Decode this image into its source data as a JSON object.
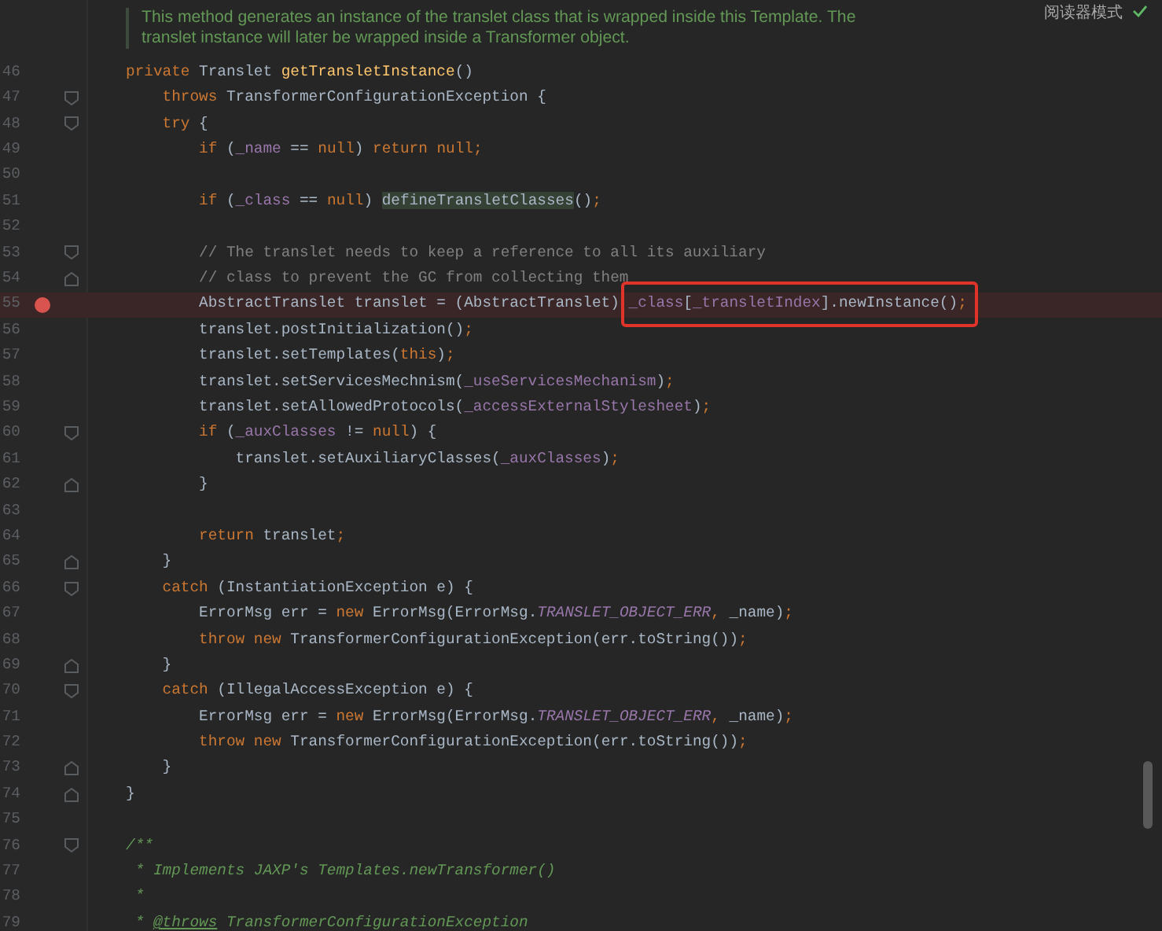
{
  "reader_mode": {
    "label": "阅读器模式"
  },
  "doc_comment": [
    "This method generates an instance of the translet class that is wrapped inside this Template. The",
    "translet instance will later be wrapped inside a Transformer object."
  ],
  "lines": [
    {
      "number": "46",
      "breakpoint": false,
      "tokens": [
        {
          "text": "private ",
          "kind": "keyword"
        },
        {
          "text": "Translet ",
          "kind": "plain"
        },
        {
          "text": "getTransletInstance",
          "kind": "declaration"
        },
        {
          "text": "()",
          "kind": "plain"
        }
      ]
    },
    {
      "number": "47",
      "breakpoint": false,
      "fold_open": true,
      "tokens": [
        {
          "text": "    throws ",
          "kind": "keyword"
        },
        {
          "text": "TransformerConfigurationException {",
          "kind": "plain"
        }
      ]
    },
    {
      "number": "48",
      "breakpoint": false,
      "fold_open": true,
      "tokens": [
        {
          "text": "    try ",
          "kind": "keyword"
        },
        {
          "text": "{",
          "kind": "plain"
        }
      ]
    },
    {
      "number": "49",
      "breakpoint": false,
      "tokens": [
        {
          "text": "        if ",
          "kind": "keyword"
        },
        {
          "text": "(",
          "kind": "plain"
        },
        {
          "text": "_name",
          "kind": "field"
        },
        {
          "text": " == ",
          "kind": "plain"
        },
        {
          "text": "null",
          "kind": "keyword"
        },
        {
          "text": ") ",
          "kind": "plain"
        },
        {
          "text": "return null;",
          "kind": "keyword"
        }
      ]
    },
    {
      "number": "50",
      "breakpoint": false
    },
    {
      "number": "51",
      "breakpoint": false,
      "tokens": [
        {
          "text": "        if ",
          "kind": "keyword"
        },
        {
          "text": "(",
          "kind": "plain"
        },
        {
          "text": "_class",
          "kind": "field"
        },
        {
          "text": " == ",
          "kind": "plain"
        },
        {
          "text": "null",
          "kind": "keyword"
        },
        {
          "text": ") ",
          "kind": "plain"
        },
        {
          "text": "defineTransletClasses",
          "kind": "plain",
          "highlighted": true
        },
        {
          "text": "()",
          "kind": "plain"
        },
        {
          "text": ";",
          "kind": "keyword"
        }
      ]
    },
    {
      "number": "52",
      "breakpoint": false
    },
    {
      "number": "53",
      "breakpoint": false,
      "fold_open": true,
      "tokens": [
        {
          "text": "        // The translet needs to keep a reference to all its auxiliary",
          "kind": "comment"
        }
      ]
    },
    {
      "number": "54",
      "breakpoint": false,
      "fold_close": true,
      "tokens": [
        {
          "text": "        // class to prevent the GC from collecting them",
          "kind": "comment"
        }
      ]
    },
    {
      "number": "55",
      "breakpoint": true,
      "tokens": [
        {
          "text": "        AbstractTranslet translet = (AbstractTranslet) ",
          "kind": "plain"
        },
        {
          "text": "_class",
          "kind": "field",
          "boxed": true
        },
        {
          "text": "[",
          "kind": "plain",
          "boxed": true
        },
        {
          "text": "_transletIndex",
          "kind": "field",
          "boxed": true
        },
        {
          "text": "].newInstance()",
          "kind": "plain",
          "boxed": true
        },
        {
          "text": ";",
          "kind": "keyword",
          "boxed": true
        }
      ]
    },
    {
      "number": "56",
      "breakpoint": false,
      "tokens": [
        {
          "text": "        translet.postInitialization()",
          "kind": "plain"
        },
        {
          "text": ";",
          "kind": "keyword"
        }
      ]
    },
    {
      "number": "57",
      "breakpoint": false,
      "tokens": [
        {
          "text": "        translet.setTemplates(",
          "kind": "plain"
        },
        {
          "text": "this",
          "kind": "keyword"
        },
        {
          "text": ")",
          "kind": "plain"
        },
        {
          "text": ";",
          "kind": "keyword"
        }
      ]
    },
    {
      "number": "58",
      "breakpoint": false,
      "tokens": [
        {
          "text": "        translet.setServicesMechnism(",
          "kind": "plain"
        },
        {
          "text": "_useServicesMechanism",
          "kind": "field"
        },
        {
          "text": ")",
          "kind": "plain"
        },
        {
          "text": ";",
          "kind": "keyword"
        }
      ]
    },
    {
      "number": "59",
      "breakpoint": false,
      "tokens": [
        {
          "text": "        translet.setAllowedProtocols(",
          "kind": "plain"
        },
        {
          "text": "_accessExternalStylesheet",
          "kind": "field"
        },
        {
          "text": ")",
          "kind": "plain"
        },
        {
          "text": ";",
          "kind": "keyword"
        }
      ]
    },
    {
      "number": "60",
      "breakpoint": false,
      "fold_open": true,
      "tokens": [
        {
          "text": "        if ",
          "kind": "keyword"
        },
        {
          "text": "(",
          "kind": "plain"
        },
        {
          "text": "_auxClasses",
          "kind": "field"
        },
        {
          "text": " != ",
          "kind": "plain"
        },
        {
          "text": "null",
          "kind": "keyword"
        },
        {
          "text": ") {",
          "kind": "plain"
        }
      ]
    },
    {
      "number": "61",
      "breakpoint": false,
      "tokens": [
        {
          "text": "            translet.setAuxiliaryClasses(",
          "kind": "plain"
        },
        {
          "text": "_auxClasses",
          "kind": "field"
        },
        {
          "text": ")",
          "kind": "plain"
        },
        {
          "text": ";",
          "kind": "keyword"
        }
      ]
    },
    {
      "number": "62",
      "breakpoint": false,
      "fold_close": true,
      "tokens": [
        {
          "text": "        }",
          "kind": "plain"
        }
      ]
    },
    {
      "number": "63",
      "breakpoint": false
    },
    {
      "number": "64",
      "breakpoint": false,
      "tokens": [
        {
          "text": "        return ",
          "kind": "keyword"
        },
        {
          "text": "translet",
          "kind": "plain"
        },
        {
          "text": ";",
          "kind": "keyword"
        }
      ]
    },
    {
      "number": "65",
      "breakpoint": false,
      "fold_close": true,
      "tokens": [
        {
          "text": "    }",
          "kind": "plain"
        }
      ]
    },
    {
      "number": "66",
      "breakpoint": false,
      "fold_open": true,
      "tokens": [
        {
          "text": "    catch ",
          "kind": "keyword"
        },
        {
          "text": "(InstantiationException e) {",
          "kind": "plain"
        }
      ]
    },
    {
      "number": "67",
      "breakpoint": false,
      "tokens": [
        {
          "text": "        ErrorMsg err = ",
          "kind": "plain"
        },
        {
          "text": "new ",
          "kind": "keyword"
        },
        {
          "text": "ErrorMsg(ErrorMsg.",
          "kind": "plain"
        },
        {
          "text": "TRANSLET_OBJECT_ERR",
          "kind": "constant"
        },
        {
          "text": ", ",
          "kind": "keyword"
        },
        {
          "text": "_name)",
          "kind": "plain"
        },
        {
          "text": ";",
          "kind": "keyword"
        }
      ]
    },
    {
      "number": "68",
      "breakpoint": false,
      "tokens": [
        {
          "text": "        throw new ",
          "kind": "keyword"
        },
        {
          "text": "TransformerConfigurationException(err.toString())",
          "kind": "plain"
        },
        {
          "text": ";",
          "kind": "keyword"
        }
      ]
    },
    {
      "number": "69",
      "breakpoint": false,
      "fold_close": true,
      "tokens": [
        {
          "text": "    }",
          "kind": "plain"
        }
      ]
    },
    {
      "number": "70",
      "breakpoint": false,
      "fold_open": true,
      "tokens": [
        {
          "text": "    catch ",
          "kind": "keyword"
        },
        {
          "text": "(IllegalAccessException e) {",
          "kind": "plain"
        }
      ]
    },
    {
      "number": "71",
      "breakpoint": false,
      "tokens": [
        {
          "text": "        ErrorMsg err = ",
          "kind": "plain"
        },
        {
          "text": "new ",
          "kind": "keyword"
        },
        {
          "text": "ErrorMsg(ErrorMsg.",
          "kind": "plain"
        },
        {
          "text": "TRANSLET_OBJECT_ERR",
          "kind": "constant"
        },
        {
          "text": ", ",
          "kind": "keyword"
        },
        {
          "text": "_name)",
          "kind": "plain"
        },
        {
          "text": ";",
          "kind": "keyword"
        }
      ]
    },
    {
      "number": "72",
      "breakpoint": false,
      "tokens": [
        {
          "text": "        throw new ",
          "kind": "keyword"
        },
        {
          "text": "TransformerConfigurationException(err.toString())",
          "kind": "plain"
        },
        {
          "text": ";",
          "kind": "keyword"
        }
      ]
    },
    {
      "number": "73",
      "breakpoint": false,
      "fold_close": true,
      "tokens": [
        {
          "text": "    }",
          "kind": "plain"
        }
      ]
    },
    {
      "number": "74",
      "breakpoint": false,
      "fold_close": true,
      "tokens": [
        {
          "text": "}",
          "kind": "plain"
        }
      ]
    },
    {
      "number": "75",
      "breakpoint": false
    },
    {
      "number": "76",
      "breakpoint": false,
      "fold_open": true,
      "tokens": [
        {
          "text": "/**",
          "kind": "doc"
        }
      ]
    },
    {
      "number": "77",
      "breakpoint": false,
      "tokens": [
        {
          "text": " * Implements JAXP's Templates.newTransformer()",
          "kind": "doc"
        }
      ]
    },
    {
      "number": "78",
      "breakpoint": false,
      "tokens": [
        {
          "text": " *",
          "kind": "doc"
        }
      ]
    },
    {
      "number": "79",
      "breakpoint": false,
      "tokens": [
        {
          "text": " * ",
          "kind": "doc"
        },
        {
          "text": "@throws",
          "kind": "doc_tag"
        },
        {
          "text": " TransformerConfigurationException",
          "kind": "doc"
        }
      ]
    }
  ]
}
